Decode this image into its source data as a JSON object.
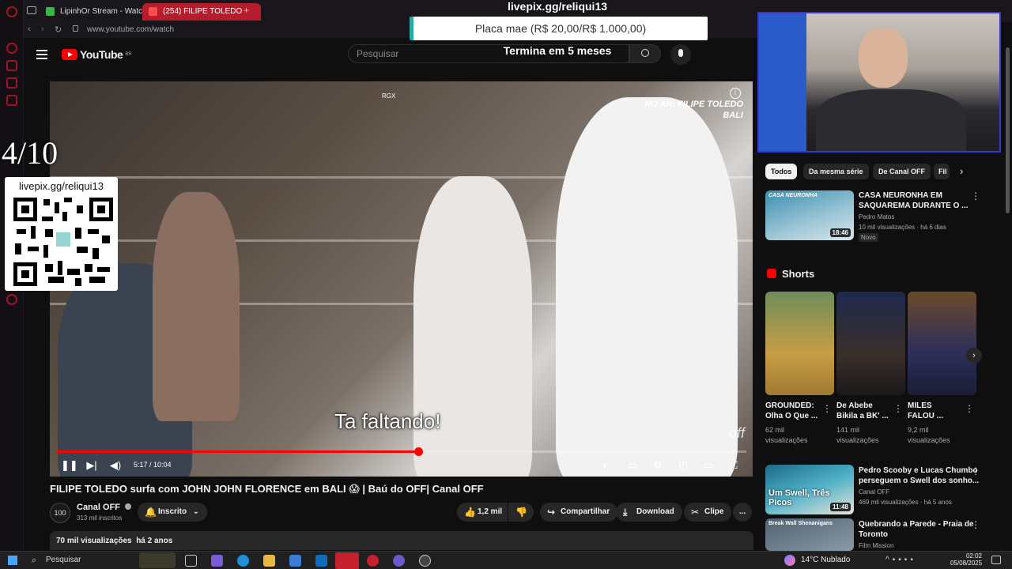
{
  "browser": {
    "tabs": [
      {
        "label": "LipinhOr Stream - Watch l",
        "active": false
      },
      {
        "label": "(254) FILIPE TOLEDO",
        "active": true
      }
    ],
    "new_tab_symbol": "+",
    "url": "www.youtube.com/watch"
  },
  "youtube": {
    "logo_text": "YouTube",
    "logo_region": "BR",
    "search_placeholder": "Pesquisar"
  },
  "overlay": {
    "livepix_url_top": "livepix.gg/reliqui13",
    "goal_text": "Placa mae (R$ 20,00/R$ 1.000,00)",
    "goal_deadline": "Termina em 5 meses",
    "rating": "4/10",
    "qr_label": "livepix.gg/reliqui13",
    "webcam_name": "webcam"
  },
  "video": {
    "caption": "Ta faltando!",
    "watermark_line1": "NO AR: FILIPE TOLEDO",
    "watermark_line2": "BALI",
    "brand_logo": "off",
    "time_current": "5:17",
    "time_total": "10:04",
    "time_display": "5:17 / 10:04",
    "progress_fraction": 0.525,
    "top_icons_label": "RGX",
    "title": "FILIPE TOLEDO surfa com JOHN JOHN FLORENCE em BALI 😱 | Baú do OFF| Canal OFF"
  },
  "channel": {
    "name": "Canal OFF",
    "subscribers": "313 mil inscritos",
    "avatar_text": "100",
    "subscribed_label": "Inscrito"
  },
  "actions": {
    "likes": "1,2 mil",
    "share": "Compartilhar",
    "download": "Download",
    "clip": "Clipe",
    "more": "..."
  },
  "description": {
    "views": "70 mil visualizações",
    "age": "há 2 anos"
  },
  "filters": [
    "Todos",
    "Da mesma série",
    "De Canal OFF",
    "Fil"
  ],
  "recommended": [
    {
      "title_line1": "CASA NEURONHA EM",
      "title_line2": "SAQUAREMA DURANTE O ...",
      "channel": "Pedro Matos",
      "meta": "10 mil visualizações · há 6 dias",
      "badge": "Novo",
      "duration": "18:46",
      "thumb_text": "CASA NEURONHA"
    }
  ],
  "shorts": {
    "heading": "Shorts",
    "items": [
      {
        "title_line1": "GROUNDED:",
        "title_line2": "Olha O Que ...",
        "views_line1": "62 mil",
        "views_line2": "visualizações"
      },
      {
        "title_line1": "De Abebe",
        "title_line2": "Bikila a BK' ...",
        "views_line1": "141 mil",
        "views_line2": "visualizações"
      },
      {
        "title_line1": "MILES",
        "title_line2": "FALOU ...",
        "views_line1": "9,2 mil",
        "views_line2": "visualizações"
      }
    ]
  },
  "more_videos": [
    {
      "title_line1": "Pedro Scooby e Lucas Chumbo",
      "title_line2": "perseguem o Swell dos sonho...",
      "channel": "Canal OFF",
      "meta": "469 mil visualizações · há 5 anos",
      "duration": "11:48",
      "thumb_text": "Um Swell, Três Picos"
    },
    {
      "title_line1": "Quebrando a Parede - Praia de",
      "title_line2": "Toronto",
      "channel": "Film Mission",
      "thumb_text": "Break Wall Shenanigans"
    }
  ],
  "taskbar": {
    "search_placeholder": "Pesquisar",
    "weather": "14°C  Nublado",
    "time": "02:02",
    "date": "05/08/2025"
  },
  "colors": {
    "yt_red": "#ff0000",
    "accent_teal": "#2aa9a3",
    "webcam_border": "#3b35d6"
  }
}
